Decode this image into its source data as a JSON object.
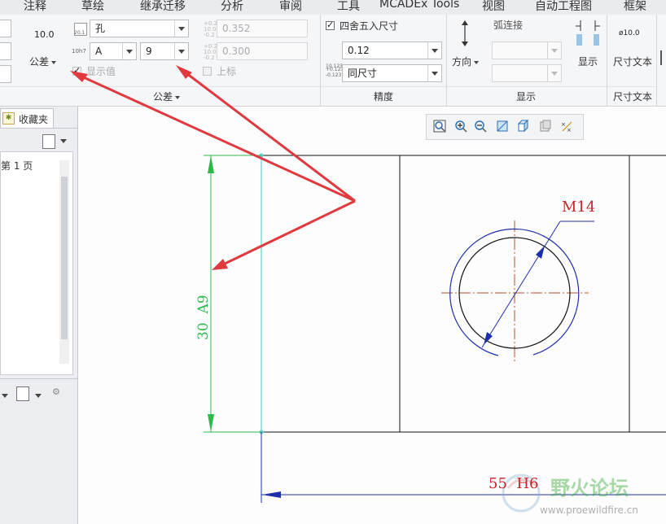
{
  "menu": [
    "注释",
    "草绘",
    "继承迁移",
    "分析",
    "审阅",
    "工具",
    "MCADEx Tools",
    "视图",
    "自动工程图",
    "框架"
  ],
  "ribbon": {
    "tolerance": {
      "label": "公差",
      "precision_value": "10.0",
      "tolerance_button": "公差",
      "hole_shaft_value": "孔",
      "position_value": "A",
      "grade_value": "9",
      "upper_value": "0.352",
      "lower_value": "0.300",
      "show_value_label": "显示值",
      "superscript_label": "上标",
      "icon_label_1": "20.1",
      "icon_label_2": "10h7",
      "icon_label_3": "+0.2\n10.0\n-0.2",
      "icon_label_4": "+0.2\n10.0\n-0.2"
    },
    "precision": {
      "label": "精度",
      "round_label": "四舍五入尺寸",
      "decimal_value": "0.12",
      "tol_precision_value": "同尺寸",
      "icon_decimal": "10.123",
      "icon_tol": "+0.123\n-0.123"
    },
    "display": {
      "label": "显示",
      "direction_label": "方向",
      "arc_connect_label": "弧连接",
      "display_button": "显示"
    },
    "dim_text": {
      "label": "尺寸文本",
      "button": "尺寸文本",
      "icon_text": "ø10.0"
    }
  },
  "left_panel": {
    "fav_tab": "收藏夹",
    "page_item": "第 1 页"
  },
  "drawing": {
    "dim_vertical": "30  A9",
    "dim_horizontal": "55  H6",
    "thread_label": "M14"
  },
  "watermark": {
    "logo_text": "野火论坛",
    "url": "www.proewildfire.cn"
  },
  "colors": {
    "dim_green": "#2fb84c",
    "dim_red": "#c8242a",
    "arrow_red": "#e0393e",
    "circle_blue": "#1d2fa8",
    "centerline": "#b5542c"
  }
}
